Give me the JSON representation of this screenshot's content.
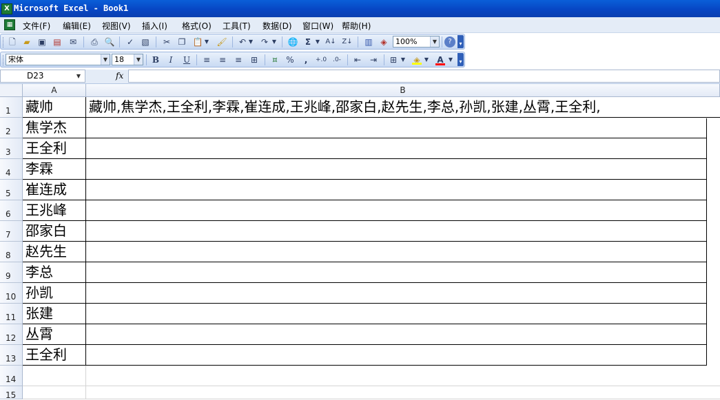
{
  "window": {
    "title": "Microsoft Excel - Book1",
    "icon": "excel-icon"
  },
  "menu": [
    "文件(F)",
    "编辑(E)",
    "视图(V)",
    "插入(I)",
    "格式(O)",
    "工具(T)",
    "数据(D)",
    "窗口(W)",
    "帮助(H)"
  ],
  "toolbar": {
    "zoom": "100%",
    "font_name": "宋体",
    "font_size": "18",
    "bold": "B",
    "italic": "I",
    "underline": "U",
    "percent": "%",
    "comma": ",",
    "autosum": "Σ",
    "help": "?",
    "font_color_letter": "A",
    "fill_color": "#ffff00",
    "font_color": "#ff0000"
  },
  "formula_bar": {
    "name_box": "D23",
    "fx": "fx",
    "formula": ""
  },
  "columns": [
    "A",
    "B"
  ],
  "rows": [
    {
      "num": "1",
      "a": "藏帅",
      "b": "藏帅,焦学杰,王全利,李霖,崔连成,王兆峰,邵家白,赵先生,李总,孙凯,张建,丛霄,王全利,"
    },
    {
      "num": "2",
      "a": "焦学杰",
      "b": ""
    },
    {
      "num": "3",
      "a": "王全利",
      "b": ""
    },
    {
      "num": "4",
      "a": "李霖",
      "b": ""
    },
    {
      "num": "5",
      "a": "崔连成",
      "b": ""
    },
    {
      "num": "6",
      "a": "王兆峰",
      "b": ""
    },
    {
      "num": "7",
      "a": "邵家白",
      "b": ""
    },
    {
      "num": "8",
      "a": "赵先生",
      "b": ""
    },
    {
      "num": "9",
      "a": "李总",
      "b": ""
    },
    {
      "num": "10",
      "a": "孙凯",
      "b": ""
    },
    {
      "num": "11",
      "a": "张建",
      "b": ""
    },
    {
      "num": "12",
      "a": "丛霄",
      "b": ""
    },
    {
      "num": "13",
      "a": "王全利",
      "b": ""
    },
    {
      "num": "14",
      "a": "",
      "b": ""
    },
    {
      "num": "15",
      "a": "",
      "b": ""
    }
  ]
}
